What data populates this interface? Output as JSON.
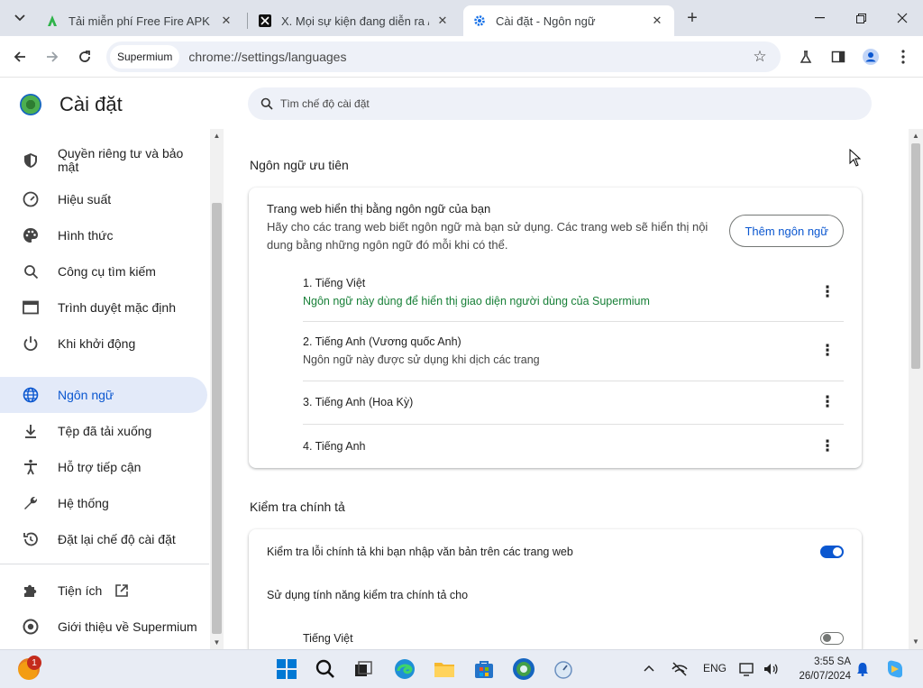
{
  "browser": {
    "tabs": [
      {
        "title": "Tải miễn phí Free Fire APK cho",
        "favicon": "apk-green-icon",
        "active": false
      },
      {
        "title": "X. Mọi sự kiện đang diễn ra / X",
        "favicon": "x-icon",
        "active": false
      },
      {
        "title": "Cài đặt - Ngôn ngữ",
        "favicon": "gear-icon",
        "active": true
      }
    ],
    "omnibox": {
      "chip": "Supermium",
      "url": "chrome://settings/languages"
    }
  },
  "sidebar": {
    "title": "Cài đặt",
    "items": [
      {
        "label": "Quyền riêng tư và bảo mật",
        "icon": "shield-icon",
        "active": false
      },
      {
        "label": "Hiệu suất",
        "icon": "speedometer-icon",
        "active": false
      },
      {
        "label": "Hình thức",
        "icon": "palette-icon",
        "active": false
      },
      {
        "label": "Công cụ tìm kiếm",
        "icon": "search-icon",
        "active": false
      },
      {
        "label": "Trình duyệt mặc định",
        "icon": "browser-window-icon",
        "active": false
      },
      {
        "label": "Khi khởi động",
        "icon": "power-icon",
        "active": false
      },
      {
        "label": "Ngôn ngữ",
        "icon": "globe-icon",
        "active": true
      },
      {
        "label": "Tệp đã tải xuống",
        "icon": "download-icon",
        "active": false
      },
      {
        "label": "Hỗ trợ tiếp cận",
        "icon": "accessibility-icon",
        "active": false
      },
      {
        "label": "Hệ thống",
        "icon": "wrench-icon",
        "active": false
      },
      {
        "label": "Đặt lại chế độ cài đặt",
        "icon": "reset-icon",
        "active": false
      },
      {
        "label": "Tiện ích",
        "icon": "puzzle-icon",
        "active": false
      },
      {
        "label": "Giới thiệu về Supermium",
        "icon": "supermium-logo-icon",
        "active": false
      }
    ]
  },
  "search": {
    "placeholder": "Tìm chế độ cài đặt"
  },
  "languages": {
    "section_title": "Ngôn ngữ ưu tiên",
    "heading": "Trang web hiển thị bằng ngôn ngữ của bạn",
    "description": "Hãy cho các trang web biết ngôn ngữ mà bạn sử dụng. Các trang web sẽ hiển thị nội dung bằng những ngôn ngữ đó mỗi khi có thể.",
    "add_button": "Thêm ngôn ngữ",
    "list": [
      {
        "name": "1. Tiếng Việt",
        "note": "Ngôn ngữ này dùng để hiển thị giao diện người dùng của Supermium",
        "note_style": "green"
      },
      {
        "name": "2. Tiếng Anh (Vương quốc Anh)",
        "note": "Ngôn ngữ này được sử dụng khi dịch các trang",
        "note_style": "gray"
      },
      {
        "name": "3. Tiếng Anh (Hoa Kỳ)",
        "note": "",
        "note_style": ""
      },
      {
        "name": "4. Tiếng Anh",
        "note": "",
        "note_style": ""
      }
    ]
  },
  "spellcheck": {
    "section_title": "Kiểm tra chính tả",
    "toggle_label": "Kiểm tra lỗi chính tả khi bạn nhập văn bản trên các trang web",
    "toggle_on": true,
    "use_for_label": "Sử dụng tính năng kiểm tra chính tả cho",
    "language": "Tiếng Việt",
    "language_on": false
  },
  "taskbar": {
    "weather_badge": "1",
    "lang": "ENG",
    "time": "3:55 SA",
    "date": "26/07/2024"
  },
  "colors": {
    "accent": "#0b57d0",
    "active_nav_bg": "#e3eaf9",
    "green_note": "#188038"
  }
}
